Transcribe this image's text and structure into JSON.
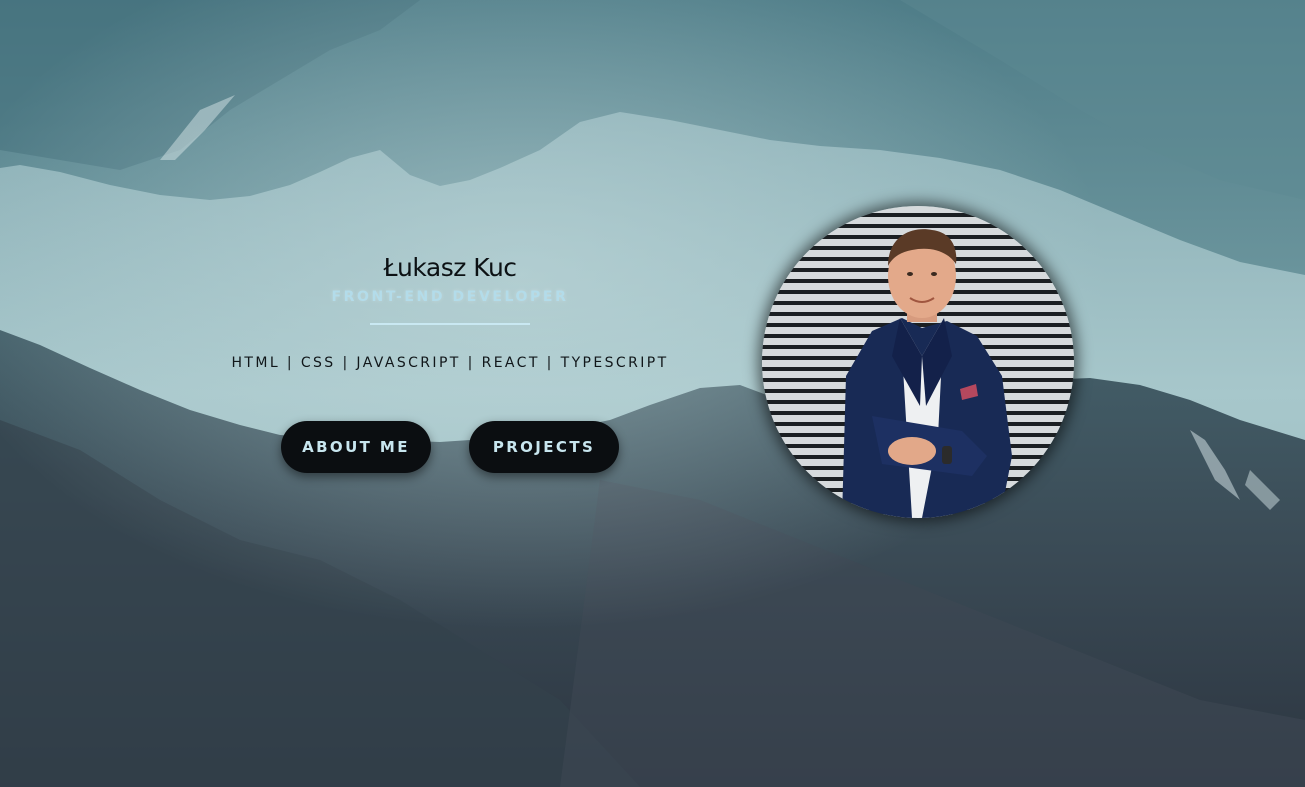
{
  "profile": {
    "name": "Łukasz Kuc",
    "role": "FRONT-END DEVELOPER",
    "skills": "HTML | CSS | JAVASCRIPT | REACT | TYPESCRIPT"
  },
  "buttons": {
    "about": "ABOUT ME",
    "projects": "PROJECTS"
  },
  "colors": {
    "accent": "#b3dcea",
    "button_bg": "#0b0e11",
    "button_text": "#c8e6ef",
    "divider": "#c9e8f2"
  },
  "images": {
    "background": "mountain-landscape",
    "avatar": "profile-photo"
  }
}
